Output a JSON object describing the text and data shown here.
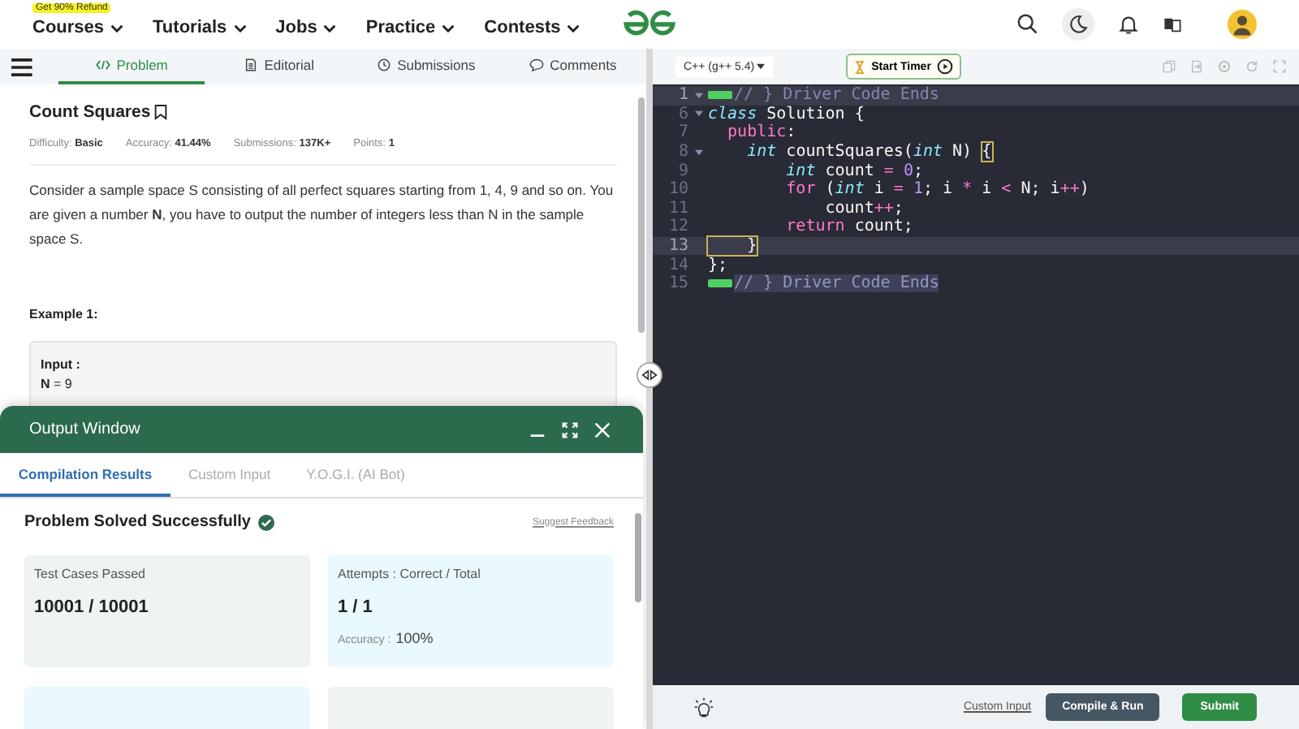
{
  "nav": {
    "promo": "Get 90% Refund",
    "items": [
      {
        "label": "Courses"
      },
      {
        "label": "Tutorials"
      },
      {
        "label": "Jobs"
      },
      {
        "label": "Practice"
      },
      {
        "label": "Contests"
      }
    ]
  },
  "problem_tabs": [
    {
      "label": "Problem",
      "selected": true
    },
    {
      "label": "Editorial",
      "selected": false
    },
    {
      "label": "Submissions",
      "selected": false
    },
    {
      "label": "Comments",
      "selected": false
    }
  ],
  "problem": {
    "title": "Count Squares",
    "meta": [
      "Difficulty: **Basic**",
      "Accuracy: **41.44%**",
      "Submissions: **137K+**",
      "Points: **1**"
    ],
    "description": "Consider a sample space S consisting of all perfect squares starting from 1, 4, 9 and so on. You are given a number **N**, you have to output the number of integers less than N in the sample space S.",
    "example_title": "Example 1:",
    "example_lines": [
      "**Input :**",
      "**N** = 9"
    ]
  },
  "editor": {
    "language": "C++ (g++ 5.4)",
    "timer": "Start Timer",
    "lines": [
      {
        "number": "1",
        "foldable": true,
        "collapsed": true,
        "active": true,
        "tokens": [
          {
            "kind": "comment",
            "text": "// } Driver Code Ends"
          }
        ]
      },
      {
        "number": "6",
        "foldable": true,
        "collapsed": false,
        "active": false,
        "tokens": [
          {
            "kind": "type",
            "text": "class"
          },
          {
            "kind": "plain",
            "text": " Solution {"
          }
        ]
      },
      {
        "number": "7",
        "foldable": false,
        "collapsed": false,
        "active": false,
        "tokens": [
          {
            "kind": "keyword",
            "text": "  public"
          },
          {
            "kind": "plain",
            "text": ":"
          }
        ]
      },
      {
        "number": "8",
        "foldable": true,
        "collapsed": false,
        "active": false,
        "tokens": [
          {
            "kind": "type",
            "text": "    int"
          },
          {
            "kind": "plain",
            "text": " countSquares("
          },
          {
            "kind": "type",
            "text": "int"
          },
          {
            "kind": "plain",
            "text": " N) "
          },
          {
            "kind": "bracket",
            "text": "{"
          }
        ]
      },
      {
        "number": "9",
        "foldable": false,
        "collapsed": false,
        "active": false,
        "tokens": [
          {
            "kind": "type",
            "text": "        int"
          },
          {
            "kind": "plain",
            "text": " count "
          },
          {
            "kind": "keyword",
            "text": "="
          },
          {
            "kind": "number",
            "text": " 0"
          },
          {
            "kind": "plain",
            "text": ";"
          }
        ]
      },
      {
        "number": "10",
        "foldable": false,
        "collapsed": false,
        "active": false,
        "tokens": [
          {
            "kind": "keyword",
            "text": "        for"
          },
          {
            "kind": "plain",
            "text": " ("
          },
          {
            "kind": "type",
            "text": "int"
          },
          {
            "kind": "plain",
            "text": " i "
          },
          {
            "kind": "keyword",
            "text": "="
          },
          {
            "kind": "number",
            "text": " 1"
          },
          {
            "kind": "plain",
            "text": "; i "
          },
          {
            "kind": "keyword",
            "text": "*"
          },
          {
            "kind": "plain",
            "text": " i "
          },
          {
            "kind": "keyword",
            "text": "<"
          },
          {
            "kind": "plain",
            "text": " N; i"
          },
          {
            "kind": "keyword",
            "text": "++"
          },
          {
            "kind": "plain",
            "text": ")"
          }
        ]
      },
      {
        "number": "11",
        "foldable": false,
        "collapsed": false,
        "active": false,
        "tokens": [
          {
            "kind": "plain",
            "text": "            count"
          },
          {
            "kind": "keyword",
            "text": "++"
          },
          {
            "kind": "plain",
            "text": ";"
          }
        ]
      },
      {
        "number": "12",
        "foldable": false,
        "collapsed": false,
        "active": false,
        "tokens": [
          {
            "kind": "keyword",
            "text": "        return"
          },
          {
            "kind": "plain",
            "text": " count;"
          }
        ]
      },
      {
        "number": "13",
        "foldable": false,
        "collapsed": false,
        "active": true,
        "tokens": [
          {
            "kind": "bracket",
            "text": "    }"
          }
        ]
      },
      {
        "number": "14",
        "foldable": false,
        "collapsed": false,
        "active": false,
        "tokens": [
          {
            "kind": "plain",
            "text": "};"
          }
        ]
      },
      {
        "number": "15",
        "foldable": false,
        "collapsed": true,
        "active": false,
        "tokens": [
          {
            "kind": "selected-comment",
            "text": "// } Driver Code Ends"
          }
        ]
      }
    ],
    "custom_input_link": "Custom Input",
    "compile_button": "Compile & Run",
    "submit_button": "Submit"
  },
  "output_window": {
    "title": "Output Window",
    "tabs": [
      {
        "label": "Compilation Results",
        "selected": true
      },
      {
        "label": "Custom Input",
        "selected": false
      },
      {
        "label": "Y.O.G.I. (AI Bot)",
        "selected": false
      }
    ],
    "status": "Problem Solved Successfully",
    "feedback_link": "Suggest Feedback",
    "cards": [
      {
        "kind": "tests",
        "label": "Test Cases Passed",
        "value": "10001 / 10001"
      },
      {
        "kind": "attempts",
        "label": "Attempts : Correct / Total",
        "value": "1 / 1",
        "sub_label": "Accuracy :",
        "sub_value": "100%"
      }
    ]
  }
}
